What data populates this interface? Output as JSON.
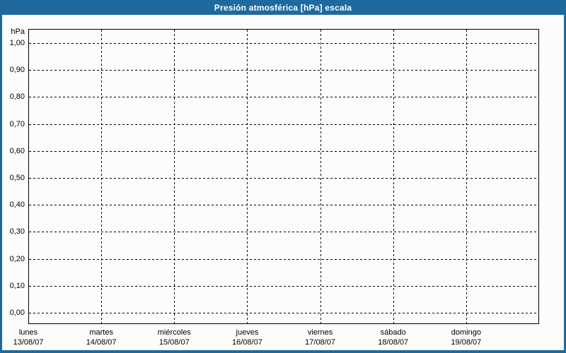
{
  "window": {
    "title": "Presión atmosférica [hPa] escala"
  },
  "colors": {
    "frame_blue": "#1E6A9E",
    "title_text": "#FFFFFF",
    "panel_bg": "#FCFDFA",
    "grid_and_axis": "#000000",
    "label_text": "#000000"
  },
  "chart_data": {
    "type": "line",
    "title": "Presión atmosférica [hPa] escala",
    "ylabel": "hPa",
    "xlabel": "",
    "grid": "dashed",
    "legend_position": "none",
    "y_axis": {
      "unit": "hPa",
      "min": 0,
      "max": 1,
      "step": 0.1,
      "tick_labels": [
        "1,00",
        "0,90",
        "0,80",
        "0,70",
        "0,60",
        "0,50",
        "0,40",
        "0,30",
        "0,20",
        "0,10",
        "0,00"
      ]
    },
    "x_axis": {
      "days": [
        {
          "name": "lunes",
          "date": "13/08/07"
        },
        {
          "name": "martes",
          "date": "14/08/07"
        },
        {
          "name": "miércoles",
          "date": "15/08/07"
        },
        {
          "name": "jueves",
          "date": "16/08/07"
        },
        {
          "name": "viernes",
          "date": "17/08/07"
        },
        {
          "name": "sábado",
          "date": "18/08/07"
        },
        {
          "name": "domingo",
          "date": "19/08/07"
        }
      ]
    },
    "series": []
  }
}
